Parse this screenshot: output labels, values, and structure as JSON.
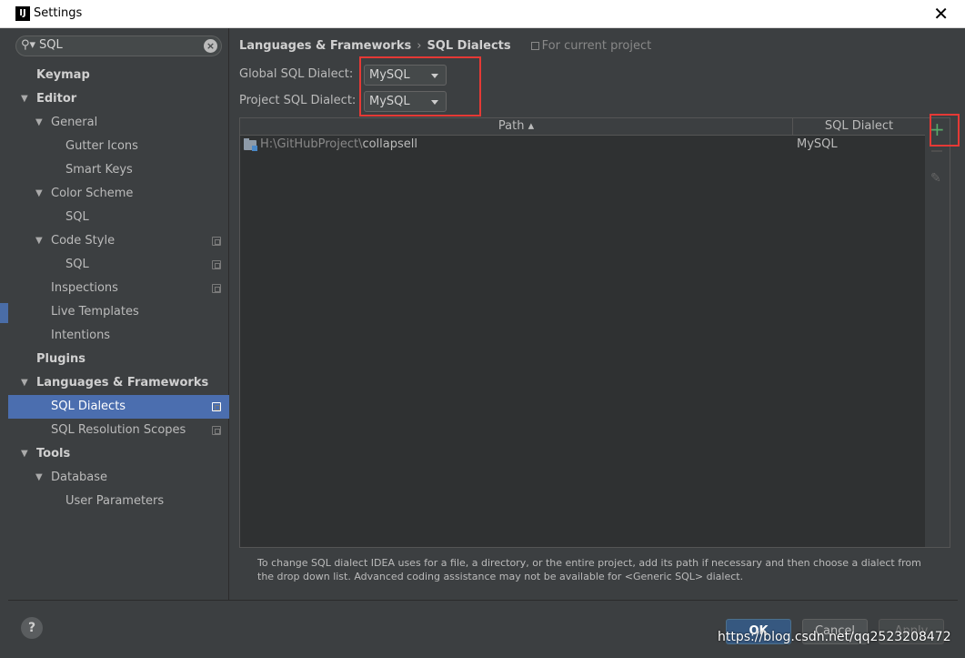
{
  "window": {
    "title": "Settings",
    "app_icon_text": "IJ"
  },
  "search": {
    "value": "SQL"
  },
  "tree": [
    {
      "label": "Keymap"
    },
    {
      "label": "Editor"
    },
    {
      "label": "General"
    },
    {
      "label": "Gutter Icons"
    },
    {
      "label": "Smart Keys"
    },
    {
      "label": "Color Scheme"
    },
    {
      "label": "SQL"
    },
    {
      "label": "Code Style"
    },
    {
      "label": "SQL"
    },
    {
      "label": "Inspections"
    },
    {
      "label": "Live Templates"
    },
    {
      "label": "Intentions"
    },
    {
      "label": "Plugins"
    },
    {
      "label": "Languages & Frameworks"
    },
    {
      "label": "SQL Dialects"
    },
    {
      "label": "SQL Resolution Scopes"
    },
    {
      "label": "Tools"
    },
    {
      "label": "Database"
    },
    {
      "label": "User Parameters"
    }
  ],
  "breadcrumb": {
    "parent": "Languages & Frameworks",
    "sep": "›",
    "current": "SQL Dialects",
    "scope": "For current project"
  },
  "global_dialect": {
    "label": "Global SQL Dialect:",
    "value": "MySQL"
  },
  "project_dialect": {
    "label": "Project SQL Dialect:",
    "value": "MySQL"
  },
  "table": {
    "col_path": "Path ▴",
    "col_dialect": "SQL Dialect",
    "rows": [
      {
        "path_dim": "H:\\GitHubProject\\",
        "path_name": "collapsell",
        "dialect": "MySQL"
      }
    ]
  },
  "tools": {
    "add": "+",
    "edit": "✎"
  },
  "hint": "To change SQL dialect IDEA uses for a file, a directory, or the entire project, add its path if necessary and then choose a dialect from the drop down list. Advanced coding assistance may not be available for <Generic SQL> dialect.",
  "footer": {
    "help": "?",
    "ok": "OK",
    "cancel": "Cancel",
    "apply": "Apply"
  },
  "watermark": "https://blog.csdn.net/qq2523208472",
  "colors": {
    "selection": "#4b6eaf",
    "highlight_box": "#e53935",
    "add_icon": "#59a869",
    "ok_button": "#365880"
  }
}
